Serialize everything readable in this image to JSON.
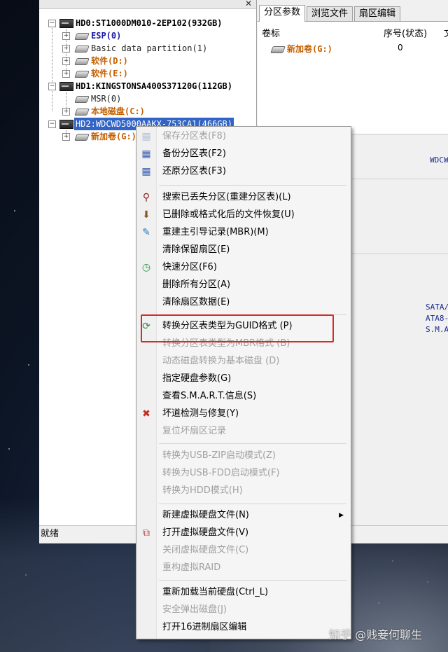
{
  "tree": {
    "items": [
      {
        "text": "HD0:ST1000DM010-2EP102(932GB)",
        "kind": "disk"
      },
      {
        "text": "ESP(0)",
        "kind": "esp"
      },
      {
        "text": "Basic data partition(1)",
        "kind": "plain"
      },
      {
        "text": "软件(D:)",
        "kind": "soft"
      },
      {
        "text": "软件(E:)",
        "kind": "soft"
      },
      {
        "text": "HD1:KINGSTONSA400S37120G(112GB)",
        "kind": "disk"
      },
      {
        "text": "MSR(0)",
        "kind": "plain"
      },
      {
        "text": "本地磁盘(C:)",
        "kind": "soft"
      },
      {
        "text": "HD2:WDCWD5000AAKX-753CA1(466GB)",
        "kind": "selected"
      },
      {
        "text": "新加卷(G:)",
        "kind": "soft"
      }
    ]
  },
  "status": {
    "text": "就绪"
  },
  "tabs": [
    {
      "label": "分区参数",
      "active": true
    },
    {
      "label": "浏览文件",
      "active": false
    },
    {
      "label": "扇区编辑",
      "active": false
    }
  ],
  "table": {
    "headers": [
      "卷标",
      "序号(状态)",
      "文"
    ],
    "row": {
      "label": "新加卷(G:)",
      "number": "0"
    }
  },
  "info": {
    "model_fragment": "WDCW",
    "iface_1": "SATA/",
    "iface_2": "ATA8-",
    "iface_3": "S.M.A"
  },
  "menu": {
    "items": [
      {
        "label": "保存分区表(F8)",
        "disabled": true,
        "icon": "save-icon"
      },
      {
        "label": "备份分区表(F2)",
        "disabled": false,
        "icon": "backup-icon"
      },
      {
        "label": "还原分区表(F3)",
        "disabled": false,
        "icon": "restore-icon"
      },
      {
        "label": "搜索已丢失分区(重建分区表)(L)",
        "disabled": false,
        "icon": "search-icon"
      },
      {
        "label": "已删除或格式化后的文件恢复(U)",
        "disabled": false,
        "icon": "recover-icon"
      },
      {
        "label": "重建主引导记录(MBR)(M)",
        "disabled": false,
        "icon": "mbr-icon"
      },
      {
        "label": "清除保留扇区(E)",
        "disabled": false,
        "icon": ""
      },
      {
        "label": "快速分区(F6)",
        "disabled": false,
        "icon": "clock-icon"
      },
      {
        "label": "删除所有分区(A)",
        "disabled": false,
        "icon": ""
      },
      {
        "label": "清除扇区数据(E)",
        "disabled": false,
        "icon": ""
      },
      {
        "label": "转换分区表类型为GUID格式 (P)",
        "disabled": false,
        "icon": "convert-icon"
      },
      {
        "label": "转换分区表类型为MBR格式 (B)",
        "disabled": true,
        "icon": ""
      },
      {
        "label": "动态磁盘转换为基本磁盘 (D)",
        "disabled": true,
        "icon": ""
      },
      {
        "label": "指定硬盘参数(G)",
        "disabled": false,
        "icon": ""
      },
      {
        "label": "查看S.M.A.R.T.信息(S)",
        "disabled": false,
        "icon": ""
      },
      {
        "label": "坏道检测与修复(Y)",
        "disabled": false,
        "icon": "tools-icon"
      },
      {
        "label": "复位坏扇区记录",
        "disabled": true,
        "icon": ""
      },
      {
        "label": "转换为USB-ZIP启动模式(Z)",
        "disabled": true,
        "icon": ""
      },
      {
        "label": "转换为USB-FDD启动模式(F)",
        "disabled": true,
        "icon": ""
      },
      {
        "label": "转换为HDD模式(H)",
        "disabled": true,
        "icon": ""
      },
      {
        "label": "新建虚拟硬盘文件(N)",
        "disabled": false,
        "icon": "",
        "submenu": true
      },
      {
        "label": "打开虚拟硬盘文件(V)",
        "disabled": false,
        "icon": "vdisk-icon"
      },
      {
        "label": "关闭虚拟硬盘文件(C)",
        "disabled": true,
        "icon": ""
      },
      {
        "label": "重构虚拟RAID",
        "disabled": true,
        "icon": ""
      },
      {
        "label": "重新加载当前硬盘(Ctrl_L)",
        "disabled": false,
        "icon": ""
      },
      {
        "label": "安全弹出磁盘(J)",
        "disabled": true,
        "icon": ""
      },
      {
        "label": "打开16进制扇区编辑",
        "disabled": false,
        "icon": ""
      }
    ]
  },
  "watermark": {
    "text": "知乎 @贱妾何聊生"
  },
  "colors": {
    "highlight": "#d52b2b",
    "selection": "#3164c4",
    "soft_text": "#c46000",
    "esp_text": "#1a1aa8"
  }
}
